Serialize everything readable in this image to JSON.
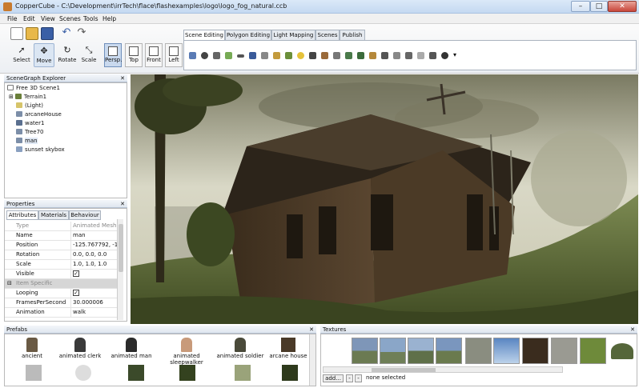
{
  "window": {
    "title": "CopperCube - C:\\Development\\irrTech\\flace\\flashexamples\\logo\\logo_fog_natural.ccb",
    "controls": {
      "minimize": "–",
      "maximize": "□",
      "close": "✕"
    }
  },
  "menu": [
    "File",
    "Edit",
    "View",
    "Scenes",
    "Tools",
    "Help"
  ],
  "toolbar": {
    "tools": [
      "Select",
      "Move",
      "Rotate",
      "Scale"
    ],
    "views": [
      "Persp.",
      "Top",
      "Front",
      "Left"
    ],
    "tabs": [
      "Scene Editing",
      "Polygon Editing",
      "Light Mapping",
      "Scenes",
      "Publish"
    ],
    "more_arrow": "▾"
  },
  "scenegraph": {
    "header": "SceneGraph Explorer",
    "close": "✕",
    "items": [
      "Free 3D Scene1",
      "Terrain1",
      "(Light)",
      "arcaneHouse",
      "water1",
      "Tree70",
      "man",
      "sunset skybox"
    ]
  },
  "properties": {
    "header": "Properties",
    "close": "✕",
    "tabs": [
      "Attributes",
      "Materials",
      "Behaviour"
    ],
    "rows": [
      {
        "key": "Type",
        "value": "Animated Mesh"
      },
      {
        "key": "Name",
        "value": "man"
      },
      {
        "key": "Position",
        "value": "-125.767792, -1.660"
      },
      {
        "key": "Rotation",
        "value": "0.0, 0.0, 0.0"
      },
      {
        "key": "Scale",
        "value": "1.0, 1.0, 1.0"
      },
      {
        "key": "Visible",
        "value": "✓"
      },
      {
        "key": "Item Specific",
        "value": ""
      },
      {
        "key": "Looping",
        "value": "✓"
      },
      {
        "key": "FramesPerSecond",
        "value": "30.000006"
      },
      {
        "key": "Animation",
        "value": "walk"
      }
    ]
  },
  "prefabs": {
    "header": "Prefabs",
    "close": "✕",
    "items": [
      "ancient",
      "animated clerk",
      "animated man",
      "animated sleepwalker",
      "animated soldier",
      "arcane house"
    ]
  },
  "textures": {
    "header": "Textures",
    "close": "✕",
    "add_label": "add...",
    "minus": "-",
    "status": "none selected"
  }
}
